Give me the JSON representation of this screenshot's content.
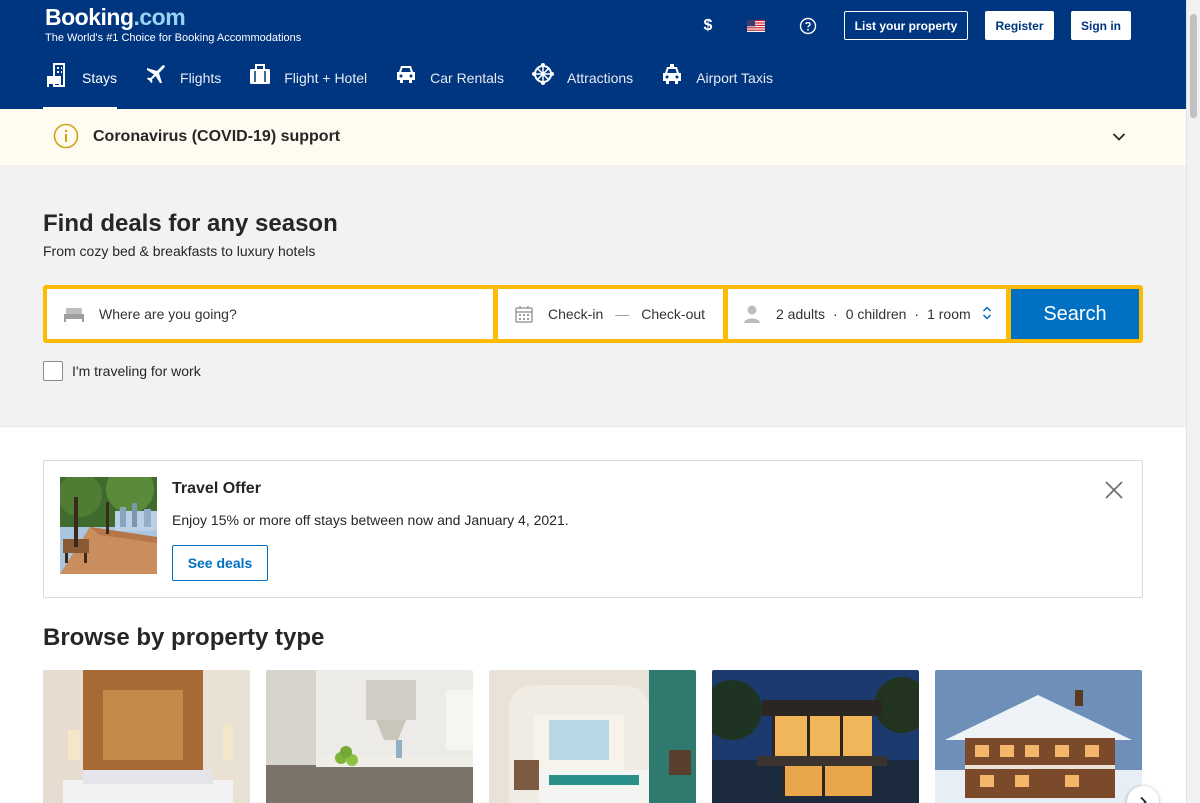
{
  "header": {
    "brand_main": "Booking",
    "brand_dot": ".com",
    "tagline": "The World's #1 Choice for Booking Accommodations",
    "currency": "$",
    "flag_icon": "us-flag-icon",
    "help_icon": "question-icon",
    "list_property": "List your property",
    "register": "Register",
    "sign_in": "Sign in",
    "background": "#003580"
  },
  "tabs": [
    {
      "label": "Stays",
      "icon": "bed-building-icon",
      "active": true
    },
    {
      "label": "Flights",
      "icon": "plane-icon",
      "active": false
    },
    {
      "label": "Flight + Hotel",
      "icon": "suitcase-icon",
      "active": false
    },
    {
      "label": "Car Rentals",
      "icon": "car-icon",
      "active": false
    },
    {
      "label": "Attractions",
      "icon": "ferris-wheel-icon",
      "active": false
    },
    {
      "label": "Airport Taxis",
      "icon": "taxi-icon",
      "active": false
    }
  ],
  "covid": {
    "text": "Coronavirus (COVID-19) support",
    "icon": "info-icon",
    "chevron": "chevron-down-icon"
  },
  "hero": {
    "title": "Find deals for any season",
    "subtitle": "From cozy bed & breakfasts to luxury hotels"
  },
  "search": {
    "destination_placeholder": "Where are you going?",
    "check_in": "Check-in",
    "dash": "—",
    "check_out": "Check-out",
    "adults": "2 adults",
    "children": "0 children",
    "rooms": "1 room",
    "sep": "·",
    "button": "Search",
    "accent": "#febb02",
    "button_color": "#0071c2"
  },
  "work_travel": {
    "label": "I'm traveling for work",
    "checked": false
  },
  "offer": {
    "title": "Travel Offer",
    "description": "Enjoy 15% or more off stays between now and January 4, 2021.",
    "button": "See deals",
    "close_icon": "close-icon"
  },
  "browse": {
    "title": "Browse by property type",
    "cards": [
      {
        "image": "hotel-bedroom-photo"
      },
      {
        "image": "apartment-kitchen-photo"
      },
      {
        "image": "resort-room-photo"
      },
      {
        "image": "modern-villa-photo"
      },
      {
        "image": "wooden-chalet-photo"
      }
    ],
    "next_icon": "chevron-right-icon"
  }
}
